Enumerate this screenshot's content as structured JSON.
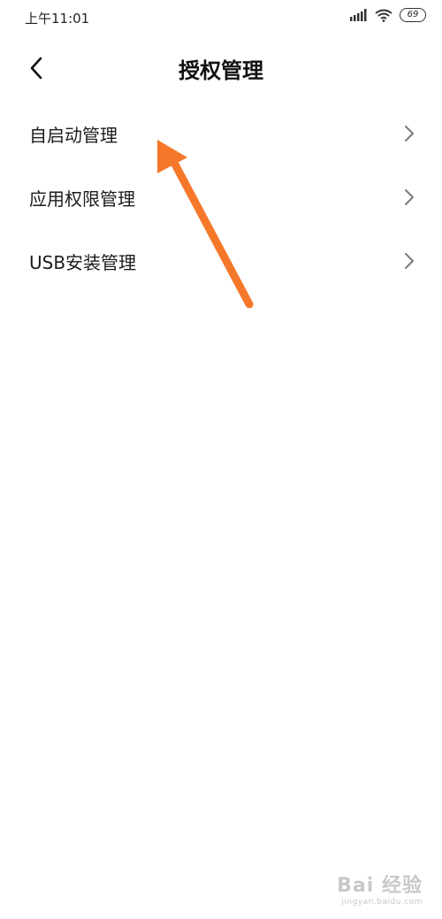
{
  "status_bar": {
    "time": "上午11:01",
    "battery": "69",
    "icons": [
      "signal-icon",
      "wifi-icon",
      "battery-icon"
    ]
  },
  "header": {
    "back_icon": "chevron-left-icon",
    "title": "授权管理"
  },
  "menu": {
    "items": [
      {
        "label": "自启动管理",
        "icon": "chevron-right-icon"
      },
      {
        "label": "应用权限管理",
        "icon": "chevron-right-icon"
      },
      {
        "label": "USB安装管理",
        "icon": "chevron-right-icon"
      }
    ]
  },
  "annotation": {
    "arrow_color": "#F5782A"
  },
  "watermark": {
    "logo": "Bai 经验",
    "url": "jingyan.baidu.com"
  }
}
